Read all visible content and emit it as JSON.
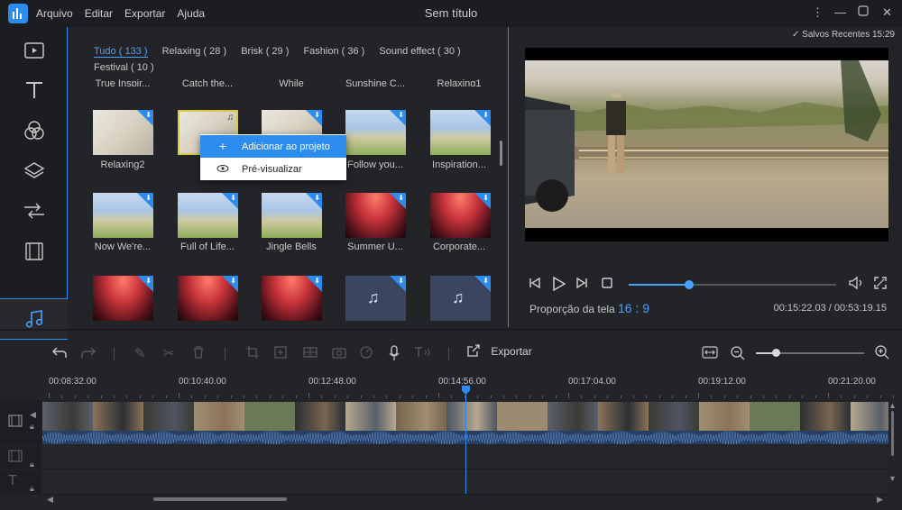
{
  "app": {
    "title": "Sem título",
    "menu": [
      "Arquivo",
      "Editar",
      "Exportar",
      "Ajuda"
    ]
  },
  "window_controls": [
    "more-icon",
    "minimize-icon",
    "maximize-icon",
    "close-icon"
  ],
  "sidebar_tools": [
    "media-icon",
    "text-icon",
    "filter-icon",
    "overlay-icon",
    "transition-icon",
    "element-icon",
    "music-icon"
  ],
  "media": {
    "categories": [
      {
        "label": "Tudo ( 133 )",
        "active": true
      },
      {
        "label": "Relaxing ( 28 )"
      },
      {
        "label": "Brisk ( 29 )"
      },
      {
        "label": "Fashion ( 36 )"
      },
      {
        "label": "Sound effect ( 30 )"
      },
      {
        "label": "Festival ( 10 )"
      }
    ],
    "partial_row": [
      "True Inspir...",
      "Catch the...",
      "While",
      "Sunshine C...",
      "Relaxing1"
    ],
    "items": [
      {
        "label": "Relaxing2"
      },
      {
        "label": "Rel"
      },
      {
        "label": ""
      },
      {
        "label": "Follow you..."
      },
      {
        "label": "Inspiration..."
      },
      {
        "label": "Now We're..."
      },
      {
        "label": "Full of Life..."
      },
      {
        "label": "Jingle Bells"
      },
      {
        "label": "Summer U..."
      },
      {
        "label": "Corporate..."
      },
      {
        "label": ""
      },
      {
        "label": ""
      },
      {
        "label": ""
      },
      {
        "label": ""
      },
      {
        "label": ""
      }
    ]
  },
  "context_menu": {
    "add": "Adicionar ao projeto",
    "preview": "Pré-visualizar"
  },
  "preview": {
    "autosave": "Salvos Recentes 15:29",
    "progress_fraction": 0.29,
    "ratio_label": "Proporção da tela",
    "ratio_value": "16 : 9",
    "timecode": "00:15:22.03 / 00:53:19.15"
  },
  "timeline": {
    "export_label": "Exportar",
    "zoom_fraction": 0.18,
    "ruler": [
      "00:08:32.00",
      "00:10:40.00",
      "00:12:48.00",
      "00:14:56.00",
      "00:17:04.00",
      "00:19:12.00",
      "00:21:20.00"
    ]
  }
}
